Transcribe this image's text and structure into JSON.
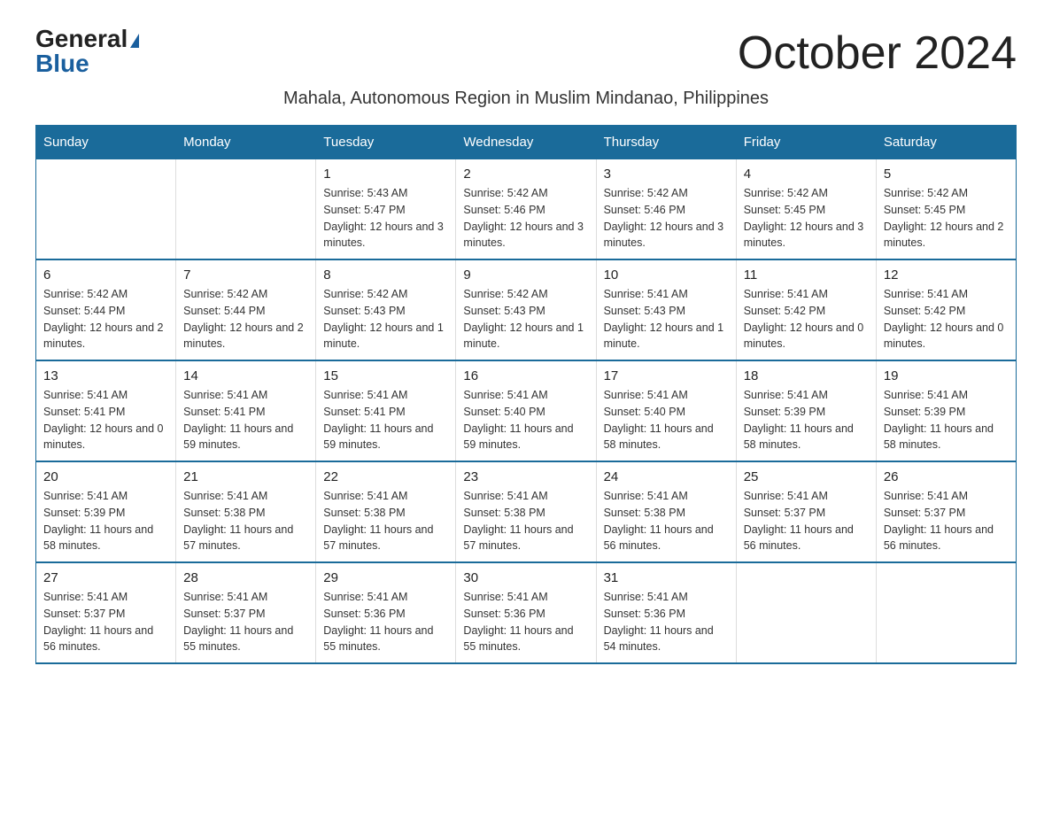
{
  "logo": {
    "general": "General",
    "blue": "Blue"
  },
  "title": "October 2024",
  "subtitle": "Mahala, Autonomous Region in Muslim Mindanao, Philippines",
  "days_of_week": [
    "Sunday",
    "Monday",
    "Tuesday",
    "Wednesday",
    "Thursday",
    "Friday",
    "Saturday"
  ],
  "weeks": [
    [
      {
        "day": "",
        "sunrise": "",
        "sunset": "",
        "daylight": ""
      },
      {
        "day": "",
        "sunrise": "",
        "sunset": "",
        "daylight": ""
      },
      {
        "day": "1",
        "sunrise": "Sunrise: 5:43 AM",
        "sunset": "Sunset: 5:47 PM",
        "daylight": "Daylight: 12 hours and 3 minutes."
      },
      {
        "day": "2",
        "sunrise": "Sunrise: 5:42 AM",
        "sunset": "Sunset: 5:46 PM",
        "daylight": "Daylight: 12 hours and 3 minutes."
      },
      {
        "day": "3",
        "sunrise": "Sunrise: 5:42 AM",
        "sunset": "Sunset: 5:46 PM",
        "daylight": "Daylight: 12 hours and 3 minutes."
      },
      {
        "day": "4",
        "sunrise": "Sunrise: 5:42 AM",
        "sunset": "Sunset: 5:45 PM",
        "daylight": "Daylight: 12 hours and 3 minutes."
      },
      {
        "day": "5",
        "sunrise": "Sunrise: 5:42 AM",
        "sunset": "Sunset: 5:45 PM",
        "daylight": "Daylight: 12 hours and 2 minutes."
      }
    ],
    [
      {
        "day": "6",
        "sunrise": "Sunrise: 5:42 AM",
        "sunset": "Sunset: 5:44 PM",
        "daylight": "Daylight: 12 hours and 2 minutes."
      },
      {
        "day": "7",
        "sunrise": "Sunrise: 5:42 AM",
        "sunset": "Sunset: 5:44 PM",
        "daylight": "Daylight: 12 hours and 2 minutes."
      },
      {
        "day": "8",
        "sunrise": "Sunrise: 5:42 AM",
        "sunset": "Sunset: 5:43 PM",
        "daylight": "Daylight: 12 hours and 1 minute."
      },
      {
        "day": "9",
        "sunrise": "Sunrise: 5:42 AM",
        "sunset": "Sunset: 5:43 PM",
        "daylight": "Daylight: 12 hours and 1 minute."
      },
      {
        "day": "10",
        "sunrise": "Sunrise: 5:41 AM",
        "sunset": "Sunset: 5:43 PM",
        "daylight": "Daylight: 12 hours and 1 minute."
      },
      {
        "day": "11",
        "sunrise": "Sunrise: 5:41 AM",
        "sunset": "Sunset: 5:42 PM",
        "daylight": "Daylight: 12 hours and 0 minutes."
      },
      {
        "day": "12",
        "sunrise": "Sunrise: 5:41 AM",
        "sunset": "Sunset: 5:42 PM",
        "daylight": "Daylight: 12 hours and 0 minutes."
      }
    ],
    [
      {
        "day": "13",
        "sunrise": "Sunrise: 5:41 AM",
        "sunset": "Sunset: 5:41 PM",
        "daylight": "Daylight: 12 hours and 0 minutes."
      },
      {
        "day": "14",
        "sunrise": "Sunrise: 5:41 AM",
        "sunset": "Sunset: 5:41 PM",
        "daylight": "Daylight: 11 hours and 59 minutes."
      },
      {
        "day": "15",
        "sunrise": "Sunrise: 5:41 AM",
        "sunset": "Sunset: 5:41 PM",
        "daylight": "Daylight: 11 hours and 59 minutes."
      },
      {
        "day": "16",
        "sunrise": "Sunrise: 5:41 AM",
        "sunset": "Sunset: 5:40 PM",
        "daylight": "Daylight: 11 hours and 59 minutes."
      },
      {
        "day": "17",
        "sunrise": "Sunrise: 5:41 AM",
        "sunset": "Sunset: 5:40 PM",
        "daylight": "Daylight: 11 hours and 58 minutes."
      },
      {
        "day": "18",
        "sunrise": "Sunrise: 5:41 AM",
        "sunset": "Sunset: 5:39 PM",
        "daylight": "Daylight: 11 hours and 58 minutes."
      },
      {
        "day": "19",
        "sunrise": "Sunrise: 5:41 AM",
        "sunset": "Sunset: 5:39 PM",
        "daylight": "Daylight: 11 hours and 58 minutes."
      }
    ],
    [
      {
        "day": "20",
        "sunrise": "Sunrise: 5:41 AM",
        "sunset": "Sunset: 5:39 PM",
        "daylight": "Daylight: 11 hours and 58 minutes."
      },
      {
        "day": "21",
        "sunrise": "Sunrise: 5:41 AM",
        "sunset": "Sunset: 5:38 PM",
        "daylight": "Daylight: 11 hours and 57 minutes."
      },
      {
        "day": "22",
        "sunrise": "Sunrise: 5:41 AM",
        "sunset": "Sunset: 5:38 PM",
        "daylight": "Daylight: 11 hours and 57 minutes."
      },
      {
        "day": "23",
        "sunrise": "Sunrise: 5:41 AM",
        "sunset": "Sunset: 5:38 PM",
        "daylight": "Daylight: 11 hours and 57 minutes."
      },
      {
        "day": "24",
        "sunrise": "Sunrise: 5:41 AM",
        "sunset": "Sunset: 5:38 PM",
        "daylight": "Daylight: 11 hours and 56 minutes."
      },
      {
        "day": "25",
        "sunrise": "Sunrise: 5:41 AM",
        "sunset": "Sunset: 5:37 PM",
        "daylight": "Daylight: 11 hours and 56 minutes."
      },
      {
        "day": "26",
        "sunrise": "Sunrise: 5:41 AM",
        "sunset": "Sunset: 5:37 PM",
        "daylight": "Daylight: 11 hours and 56 minutes."
      }
    ],
    [
      {
        "day": "27",
        "sunrise": "Sunrise: 5:41 AM",
        "sunset": "Sunset: 5:37 PM",
        "daylight": "Daylight: 11 hours and 56 minutes."
      },
      {
        "day": "28",
        "sunrise": "Sunrise: 5:41 AM",
        "sunset": "Sunset: 5:37 PM",
        "daylight": "Daylight: 11 hours and 55 minutes."
      },
      {
        "day": "29",
        "sunrise": "Sunrise: 5:41 AM",
        "sunset": "Sunset: 5:36 PM",
        "daylight": "Daylight: 11 hours and 55 minutes."
      },
      {
        "day": "30",
        "sunrise": "Sunrise: 5:41 AM",
        "sunset": "Sunset: 5:36 PM",
        "daylight": "Daylight: 11 hours and 55 minutes."
      },
      {
        "day": "31",
        "sunrise": "Sunrise: 5:41 AM",
        "sunset": "Sunset: 5:36 PM",
        "daylight": "Daylight: 11 hours and 54 minutes."
      },
      {
        "day": "",
        "sunrise": "",
        "sunset": "",
        "daylight": ""
      },
      {
        "day": "",
        "sunrise": "",
        "sunset": "",
        "daylight": ""
      }
    ]
  ]
}
